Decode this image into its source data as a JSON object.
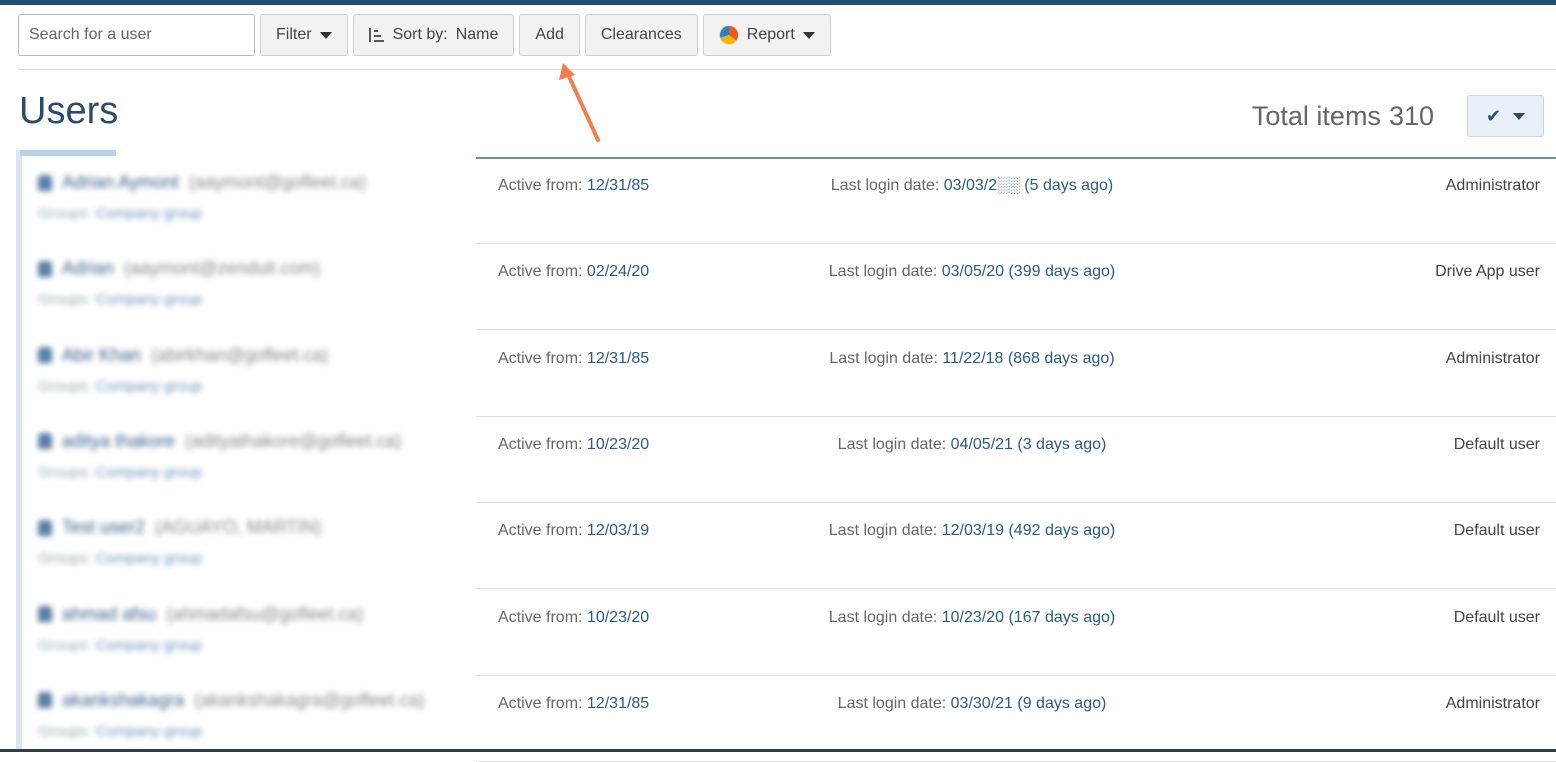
{
  "toolbar": {
    "search_placeholder": "Search for a user",
    "filter_label": "Filter",
    "sort_prefix": "Sort by:",
    "sort_value": "Name",
    "add_label": "Add",
    "clearances_label": "Clearances",
    "report_label": "Report"
  },
  "page": {
    "title": "Users",
    "total_label": "Total items",
    "total_count": "310"
  },
  "colors": {
    "accent": "#2b4a6e",
    "link": "#2b5a8a",
    "annotation_arrow": "#f08050"
  },
  "rows": [
    {
      "name": "Adrian Aymont",
      "email": "(aaymont@gofleet.ca)",
      "group_label": "Groups:",
      "group": "Company group",
      "icon": "shield-icon",
      "active_label": "Active from:",
      "active_date": "12/31/85",
      "login_label": "Last login date:",
      "login_value": "03/03/2░░ (5 days ago)",
      "role": "Administrator"
    },
    {
      "name": "Adrian",
      "email": "(aaymont@zenduit.com)",
      "group_label": "Groups:",
      "group": "Company group",
      "icon": "user-icon",
      "active_label": "Active from:",
      "active_date": "02/24/20",
      "login_label": "Last login date:",
      "login_value": "03/05/20 (399 days ago)",
      "role": "Drive App user"
    },
    {
      "name": "Abir Khan",
      "email": "(abirkhan@gofleet.ca)",
      "group_label": "Groups:",
      "group": "Company group",
      "icon": "shield-icon",
      "active_label": "Active from:",
      "active_date": "12/31/85",
      "login_label": "Last login date:",
      "login_value": "11/22/18 (868 days ago)",
      "role": "Administrator"
    },
    {
      "name": "aditya thakore",
      "email": "(adityathakore@gofleet.ca)",
      "group_label": "Groups:",
      "group": "Company group",
      "icon": "user-icon",
      "active_label": "Active from:",
      "active_date": "10/23/20",
      "login_label": "Last login date:",
      "login_value": "04/05/21 (3 days ago)",
      "role": "Default user"
    },
    {
      "name": "Test user2",
      "email": "(AGUAYO, MARTIN)",
      "group_label": "Groups:",
      "group": "Company group",
      "icon": "user-icon",
      "active_label": "Active from:",
      "active_date": "12/03/19",
      "login_label": "Last login date:",
      "login_value": "12/03/19 (492 days ago)",
      "role": "Default user"
    },
    {
      "name": "ahmad afsu",
      "email": "(ahmadafsu@gofleet.ca)",
      "group_label": "Groups:",
      "group": "Company group",
      "icon": "user-icon",
      "active_label": "Active from:",
      "active_date": "10/23/20",
      "login_label": "Last login date:",
      "login_value": "10/23/20 (167 days ago)",
      "role": "Default user"
    },
    {
      "name": "akankshakagra",
      "email": "(akankshakagra@gofleet.ca)",
      "group_label": "Groups:",
      "group": "Company group",
      "icon": "user-icon",
      "active_label": "Active from:",
      "active_date": "12/31/85",
      "login_label": "Last login date:",
      "login_value": "03/30/21 (9 days ago)",
      "role": "Administrator"
    }
  ]
}
